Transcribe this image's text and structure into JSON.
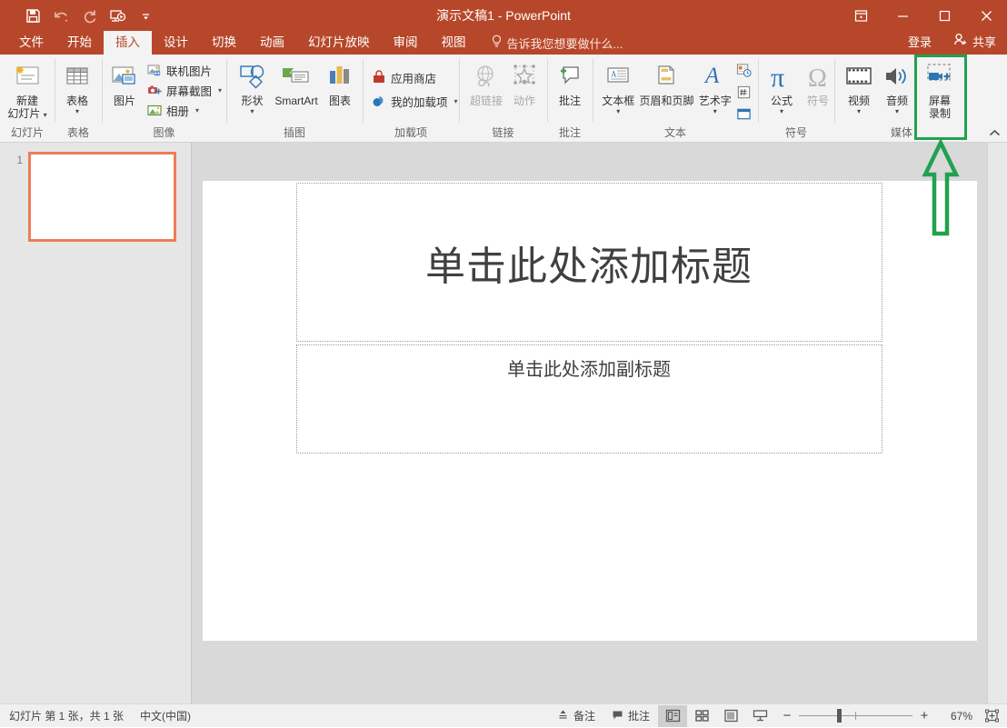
{
  "window": {
    "title": "演示文稿1 - PowerPoint",
    "quick_access": [
      {
        "name": "save-icon",
        "label": "保存"
      },
      {
        "name": "undo-icon",
        "label": "撤消"
      },
      {
        "name": "redo-icon",
        "label": "重复"
      },
      {
        "name": "start-from-beginning-icon",
        "label": "从头开始"
      },
      {
        "name": "customize-quick-access-icon",
        "label": "自定义快速访问工具栏"
      }
    ],
    "controls": [
      {
        "name": "ribbon-display-options",
        "glyph": "ribbon"
      },
      {
        "name": "minimize",
        "glyph": "—"
      },
      {
        "name": "maximize",
        "glyph": "□"
      },
      {
        "name": "close",
        "glyph": "✕"
      }
    ]
  },
  "tabs": [
    {
      "label": "文件",
      "active": false
    },
    {
      "label": "开始",
      "active": false
    },
    {
      "label": "插入",
      "active": true
    },
    {
      "label": "设计",
      "active": false
    },
    {
      "label": "切换",
      "active": false
    },
    {
      "label": "动画",
      "active": false
    },
    {
      "label": "幻灯片放映",
      "active": false
    },
    {
      "label": "审阅",
      "active": false
    },
    {
      "label": "视图",
      "active": false
    }
  ],
  "tell_me": "告诉我您想要做什么...",
  "account": {
    "sign_in": "登录",
    "share": "共享"
  },
  "ribbon": {
    "collapse_label": "折叠功能区",
    "groups": [
      {
        "label": "幻灯片",
        "big": [
          {
            "label1": "新建",
            "label2": "幻灯片",
            "icon": "new-slide-icon",
            "caret": true
          }
        ]
      },
      {
        "label": "表格",
        "big": [
          {
            "label1": "表格",
            "label2": "",
            "icon": "table-icon",
            "caret": true
          }
        ]
      },
      {
        "label": "图像",
        "big": [
          {
            "label1": "图片",
            "label2": "",
            "icon": "picture-icon",
            "caret": false
          }
        ],
        "small": [
          {
            "label": "联机图片",
            "icon": "online-pictures-icon",
            "caret": false
          },
          {
            "label": "屏幕截图",
            "icon": "screenshot-icon",
            "caret": true
          },
          {
            "label": "相册",
            "icon": "photo-album-icon",
            "caret": true
          }
        ]
      },
      {
        "label": "插图",
        "big": [
          {
            "label1": "形状",
            "label2": "",
            "icon": "shapes-icon",
            "caret": true
          },
          {
            "label1": "SmartArt",
            "label2": "",
            "icon": "smartart-icon",
            "caret": false
          },
          {
            "label1": "图表",
            "label2": "",
            "icon": "chart-icon",
            "caret": false
          }
        ]
      },
      {
        "label": "加载项",
        "small": [
          {
            "label": "应用商店",
            "icon": "store-icon",
            "caret": false
          },
          {
            "label": "我的加载项",
            "icon": "my-addins-icon",
            "caret": true
          }
        ]
      },
      {
        "label": "链接",
        "big": [
          {
            "label1": "超链接",
            "label2": "",
            "icon": "hyperlink-icon",
            "caret": false,
            "disabled": true
          },
          {
            "label1": "动作",
            "label2": "",
            "icon": "action-icon",
            "caret": false,
            "disabled": true
          }
        ]
      },
      {
        "label": "批注",
        "big": [
          {
            "label1": "批注",
            "label2": "",
            "icon": "comment-icon",
            "caret": false
          }
        ]
      },
      {
        "label": "文本",
        "big": [
          {
            "label1": "文本框",
            "label2": "",
            "icon": "text-box-icon",
            "caret": true
          },
          {
            "label1": "页眉和页脚",
            "label2": "",
            "icon": "header-footer-icon",
            "caret": false
          },
          {
            "label1": "艺术字",
            "label2": "",
            "icon": "wordart-icon",
            "caret": true
          }
        ],
        "stack": [
          {
            "icon": "date-time-icon",
            "label": "日期和时间"
          },
          {
            "icon": "slide-number-icon",
            "label": "幻灯片编号"
          },
          {
            "icon": "object-icon",
            "label": "对象"
          }
        ]
      },
      {
        "label": "符号",
        "big": [
          {
            "label1": "公式",
            "label2": "",
            "icon": "equation-icon",
            "caret": true
          },
          {
            "label1": "符号",
            "label2": "",
            "icon": "symbol-icon",
            "caret": false,
            "disabled": true
          }
        ]
      },
      {
        "label": "媒体",
        "big": [
          {
            "label1": "视频",
            "label2": "",
            "icon": "video-icon",
            "caret": true
          },
          {
            "label1": "音频",
            "label2": "",
            "icon": "audio-icon",
            "caret": true
          },
          {
            "label1": "屏幕",
            "label2": "录制",
            "icon": "screen-recording-icon",
            "caret": false,
            "highlighted": true
          }
        ]
      }
    ]
  },
  "annotation": {
    "highlight_color": "#22a14f",
    "target": "屏幕录制",
    "arrow": "up-arrow"
  },
  "slides_pane": {
    "slides": [
      {
        "number": "1",
        "selected": true
      }
    ],
    "selection_color": "#ec7e57"
  },
  "slide": {
    "title_placeholder": "单击此处添加标题",
    "subtitle_placeholder": "单击此处添加副标题"
  },
  "status_bar": {
    "slide_count": "幻灯片 第 1 张，共 1 张",
    "language": "中文(中国)",
    "notes": "备注",
    "comments": "批注",
    "views": [
      {
        "name": "normal-view",
        "selected": true
      },
      {
        "name": "slide-sorter-view",
        "selected": false
      },
      {
        "name": "reading-view",
        "selected": false
      },
      {
        "name": "slide-show-view",
        "selected": false
      }
    ],
    "zoom_out": "−",
    "zoom_in": "+",
    "zoom_level": "67%",
    "fit_to_window": "使幻灯片适应当前窗口"
  }
}
